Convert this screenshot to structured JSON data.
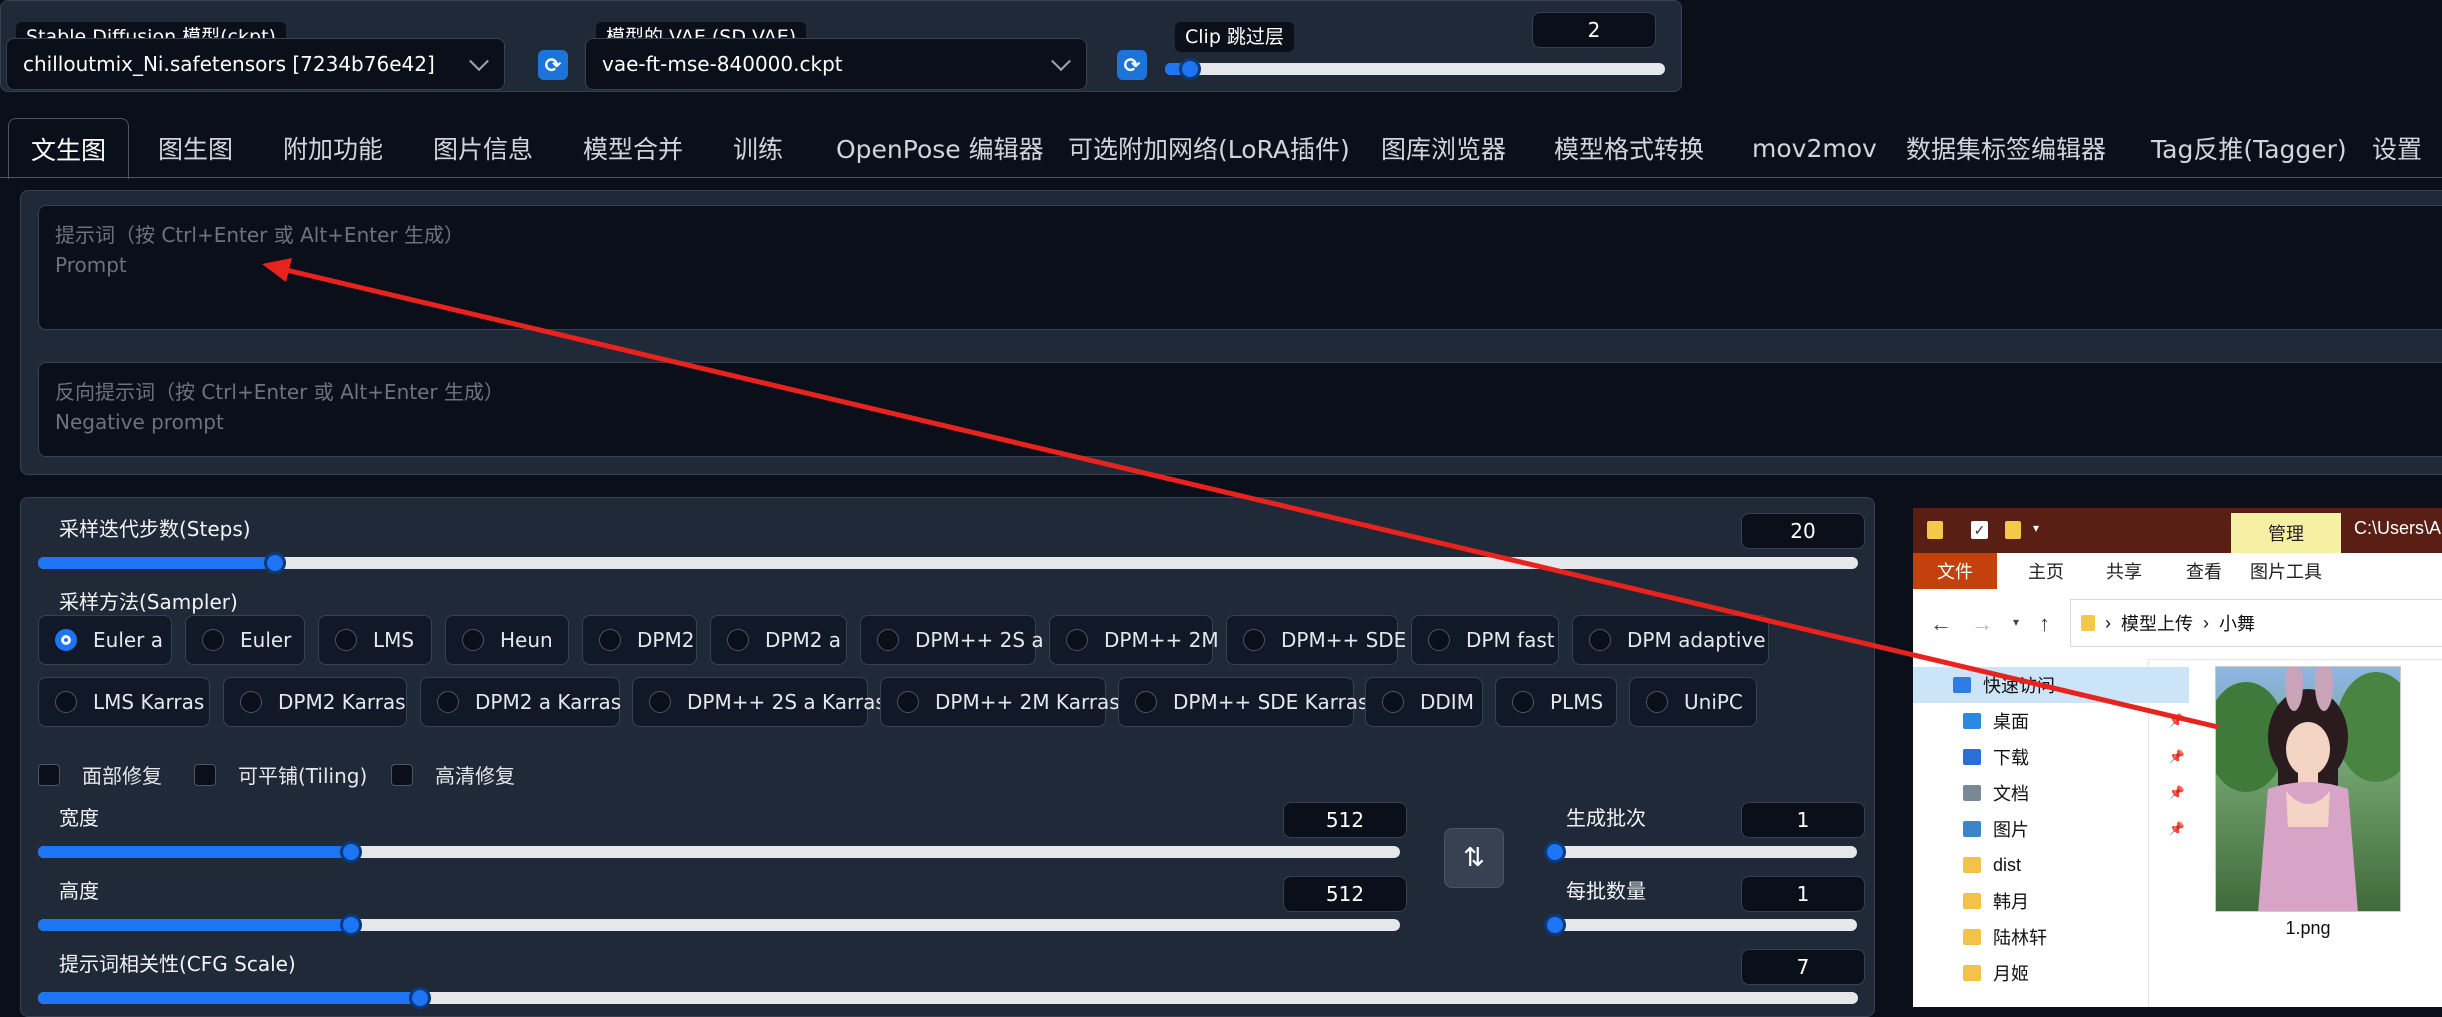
{
  "top": {
    "ckpt_label": "Stable Diffusion 模型(ckpt)",
    "ckpt_value": "chilloutmix_Ni.safetensors [7234b76e42]",
    "vae_label": "模型的 VAE (SD VAE)",
    "vae_value": "vae-ft-mse-840000.ckpt",
    "clip_label": "Clip 跳过层",
    "clip_value": "2",
    "clip_level": 0.05,
    "refresh_icon": "refresh-icon"
  },
  "tabs": [
    "文生图",
    "图生图",
    "附加功能",
    "图片信息",
    "模型合并",
    "训练",
    "OpenPose 编辑器",
    "可选附加网络(LoRA插件)",
    "图库浏览器",
    "模型格式转换",
    "mov2mov",
    "数据集标签编辑器",
    "Tag反推(Tagger)",
    "设置"
  ],
  "prompt": {
    "placeholder_line1": "提示词（按 Ctrl+Enter 或 Alt+Enter 生成）",
    "placeholder_line2": "Prompt"
  },
  "negative": {
    "placeholder_line1": "反向提示词（按 Ctrl+Enter 或 Alt+Enter 生成）",
    "placeholder_line2": "Negative prompt"
  },
  "steps": {
    "label": "采样迭代步数(Steps)",
    "value": "20",
    "fraction": 0.13
  },
  "sampler": {
    "label": "采样方法(Sampler)",
    "selected": "Euler a",
    "row1": [
      "Euler a",
      "Euler",
      "LMS",
      "Heun",
      "DPM2",
      "DPM2 a",
      "DPM++ 2S a",
      "DPM++ 2M",
      "DPM++ SDE",
      "DPM fast",
      "DPM adaptive"
    ],
    "row2": [
      "LMS Karras",
      "DPM2 Karras",
      "DPM2 a Karras",
      "DPM++ 2S a Karras",
      "DPM++ 2M Karras",
      "DPM++ SDE Karras",
      "DDIM",
      "PLMS",
      "UniPC"
    ]
  },
  "checks": [
    "面部修复",
    "可平铺(Tiling)",
    "高清修复"
  ],
  "width": {
    "label": "宽度",
    "value": "512",
    "fraction": 0.23
  },
  "height": {
    "label": "高度",
    "value": "512",
    "fraction": 0.23
  },
  "batch_count": {
    "label": "生成批次",
    "value": "1",
    "fraction": 0.0
  },
  "batch_size": {
    "label": "每批数量",
    "value": "1",
    "fraction": 0.0
  },
  "cfg": {
    "label": "提示词相关性(CFG Scale)",
    "value": "7",
    "fraction": 0.21
  },
  "swap_icon": "swap-dimensions-icon",
  "explorer": {
    "manage_tab": "管理",
    "path_title": "C:\\Users\\A",
    "ribbon_tabs": [
      "文件",
      "主页",
      "共享",
      "查看",
      "图片工具"
    ],
    "breadcrumb": [
      "模型上传",
      "小舞"
    ],
    "nav_items": [
      {
        "label": "快速访问",
        "icon": "star-icon",
        "color": "#2f7de1"
      },
      {
        "label": "桌面",
        "icon": "desktop-icon",
        "color": "#2b8ae0"
      },
      {
        "label": "下载",
        "icon": "download-icon",
        "color": "#2b6fd6"
      },
      {
        "label": "文档",
        "icon": "document-icon",
        "color": "#7a8896"
      },
      {
        "label": "图片",
        "icon": "pictures-icon",
        "color": "#3a86c8"
      },
      {
        "label": "dist",
        "icon": "folder-icon",
        "color": "#f2c24b"
      },
      {
        "label": "韩月",
        "icon": "folder-icon",
        "color": "#f2c24b"
      },
      {
        "label": "陆林轩",
        "icon": "folder-icon",
        "color": "#f2c24b"
      },
      {
        "label": "月姬",
        "icon": "folder-icon",
        "color": "#f2c24b"
      }
    ],
    "file_name": "1.png"
  },
  "colors": {
    "accent": "#1d74f5",
    "arrow": "#e8231d",
    "bg": "#0b0f19",
    "panel": "#1f2937"
  }
}
